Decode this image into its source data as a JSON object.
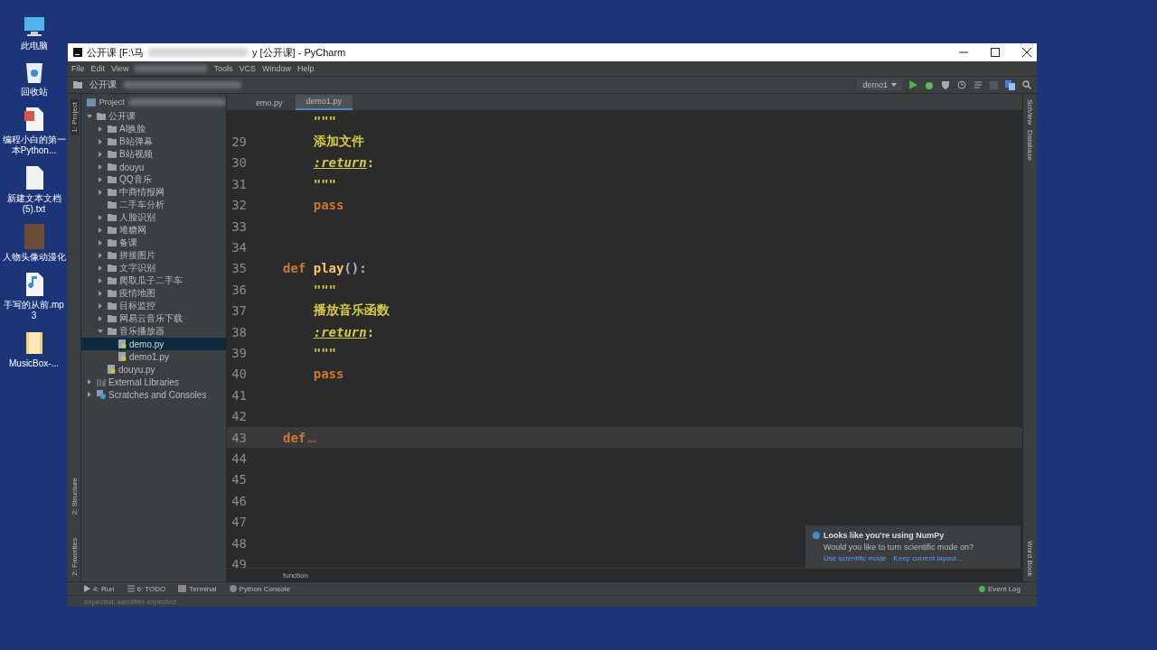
{
  "desktop_icons": [
    {
      "label": "此电脑",
      "kind": "computer"
    },
    {
      "label": "回收站",
      "kind": "bin"
    },
    {
      "label": "编程小白的第一本Python...",
      "kind": "pdf"
    },
    {
      "label": "新建文本文档(5).txt",
      "kind": "text"
    },
    {
      "label": "人物头像动漫化",
      "kind": "picture"
    },
    {
      "label": "手写的从前.mp3",
      "kind": "audio"
    },
    {
      "label": "MusicBox-...",
      "kind": "folder"
    }
  ],
  "window": {
    "title_start": "公开课 [F:\\马",
    "title_end": "y [公开课] - PyCharm"
  },
  "menu_start": [
    "File",
    "Edit",
    "View"
  ],
  "menu_end": [
    "Tools",
    "VCS",
    "Window",
    "Help"
  ],
  "nav": "公开课",
  "left_strip": [
    {
      "label": "1: Project",
      "selected": true
    },
    {
      "label": "2: Structure",
      "selected": false
    },
    {
      "label": "2: Favorites",
      "selected": false
    }
  ],
  "project_header": "Project",
  "tree": [
    {
      "label": "公开课",
      "kind": "folder",
      "expanded": true,
      "selected": false,
      "children": [
        {
          "label": "AI换脸",
          "kind": "folder",
          "expanded": false,
          "selected": false
        },
        {
          "label": "B站弹幕",
          "kind": "folder",
          "expanded": false,
          "selected": false
        },
        {
          "label": "B站视频",
          "kind": "folder",
          "expanded": false,
          "selected": false
        },
        {
          "label": "douyu",
          "kind": "folder",
          "expanded": false,
          "selected": false
        },
        {
          "label": "QQ音乐",
          "kind": "folder",
          "expanded": false,
          "selected": false
        },
        {
          "label": "中商情报网",
          "kind": "folder",
          "expanded": false,
          "selected": false
        },
        {
          "label": "二手车分析",
          "kind": "folder",
          "selected": false
        },
        {
          "label": "人脸识别",
          "kind": "folder",
          "expanded": false,
          "selected": false
        },
        {
          "label": "堆糖网",
          "kind": "folder",
          "expanded": false,
          "selected": false
        },
        {
          "label": "备课",
          "kind": "folder",
          "expanded": false,
          "selected": false
        },
        {
          "label": "拼接图片",
          "kind": "folder",
          "expanded": false,
          "selected": false
        },
        {
          "label": "文字识别",
          "kind": "folder",
          "expanded": false,
          "selected": false
        },
        {
          "label": "爬取瓜子二手车",
          "kind": "folder",
          "expanded": false,
          "selected": false
        },
        {
          "label": "疫情地图",
          "kind": "folder",
          "expanded": false,
          "selected": false
        },
        {
          "label": "目标监控",
          "kind": "folder",
          "expanded": false,
          "selected": false
        },
        {
          "label": "网易云音乐下载",
          "kind": "folder",
          "expanded": false,
          "selected": false
        },
        {
          "label": "音乐播放器",
          "kind": "folder",
          "expanded": true,
          "selected": false,
          "children": [
            {
              "label": "demo.py",
              "kind": "file",
              "selected": true
            },
            {
              "label": "demo1.py",
              "kind": "file",
              "selected": false
            }
          ]
        },
        {
          "label": "douyu.py",
          "kind": "file",
          "selected": false
        }
      ]
    },
    {
      "label": "External Libraries",
      "kind": "library",
      "expanded": false,
      "selected": false
    },
    {
      "label": "Scratches and Consoles",
      "kind": "scratches",
      "expanded": false,
      "selected": false
    }
  ],
  "tabs": [
    {
      "label": "emo.py",
      "selected": false
    },
    {
      "label": "demo1.py",
      "selected": true
    }
  ],
  "run_config": "demo1",
  "right_strip": [
    "SciView",
    "Database"
  ],
  "right_strip_bottom": "Word Book",
  "code_lines": [
    {
      "current": false,
      "indented": true,
      "tokens": [
        {
          "kind": "doc",
          "text": "\"\"\""
        }
      ]
    },
    {
      "number": "29",
      "current": false,
      "indented": true,
      "tokens": [
        {
          "kind": "doc",
          "text": "添加文件"
        }
      ]
    },
    {
      "number": "30",
      "current": false,
      "indented": true,
      "tokens": [
        {
          "kind": "doctag",
          "text": ":return"
        },
        {
          "kind": "doc",
          "text": ":"
        }
      ]
    },
    {
      "number": "31",
      "current": false,
      "indented": true,
      "tokens": [
        {
          "kind": "doc",
          "text": "\"\"\""
        }
      ]
    },
    {
      "number": "32",
      "current": false,
      "indented": true,
      "tokens": [
        {
          "kind": "keyword",
          "text": "pass"
        }
      ]
    },
    {
      "number": "33",
      "current": false
    },
    {
      "number": "34",
      "current": false
    },
    {
      "number": "35",
      "current": false,
      "indented": false,
      "tokens": [
        {
          "kind": "keyword",
          "text": "def "
        },
        {
          "kind": "name",
          "text": "play"
        },
        {
          "kind": "plain",
          "text": "():"
        }
      ]
    },
    {
      "number": "36",
      "current": false,
      "indented": true,
      "tokens": [
        {
          "kind": "doc",
          "text": "\"\"\""
        }
      ]
    },
    {
      "number": "37",
      "current": false,
      "indented": true,
      "tokens": [
        {
          "kind": "doc",
          "text": "播放音乐函数"
        }
      ]
    },
    {
      "number": "38",
      "current": false,
      "indented": true,
      "tokens": [
        {
          "kind": "doctag",
          "text": ":return"
        },
        {
          "kind": "doc",
          "text": ":"
        }
      ]
    },
    {
      "number": "39",
      "current": false,
      "indented": true,
      "tokens": [
        {
          "kind": "doc",
          "text": "\"\"\""
        }
      ]
    },
    {
      "number": "40",
      "current": false,
      "indented": true,
      "tokens": [
        {
          "kind": "keyword",
          "text": "pass"
        }
      ]
    },
    {
      "number": "41",
      "current": false
    },
    {
      "number": "42",
      "current": false
    },
    {
      "number": "43",
      "current": true,
      "error": true,
      "indented": false,
      "tokens": [
        {
          "kind": "keyword",
          "text": "def"
        }
      ]
    },
    {
      "number": "44",
      "current": false
    },
    {
      "number": "45",
      "current": false
    },
    {
      "number": "46",
      "current": false
    },
    {
      "number": "47",
      "current": false
    },
    {
      "number": "48",
      "current": false
    },
    {
      "number": "49",
      "current": false
    }
  ],
  "breadcrumb": "function",
  "notification": {
    "title": "Looks like you're using NumPy",
    "message": "Would you like to turn scientific mode on?",
    "links": [
      "Use scientific mode",
      "Keep current layout..."
    ]
  },
  "bottom_tabs": [
    {
      "label": "4: Run",
      "kind": "run"
    },
    {
      "label": "6: TODO",
      "kind": "todo"
    },
    {
      "label": "Terminal",
      "kind": "terminal"
    },
    {
      "label": "Python Console",
      "kind": "console"
    }
  ],
  "event_log": "Event Log",
  "status_message": "expected, identifier expected"
}
